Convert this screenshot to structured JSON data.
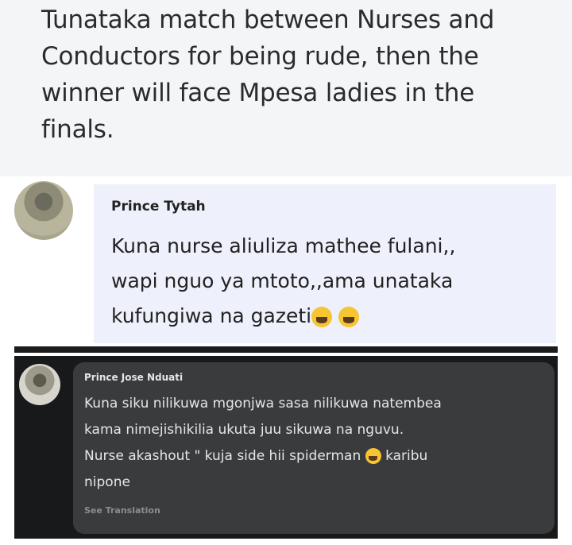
{
  "post": {
    "lines": [
      "Tunataka match between Nurses and",
      "Conductors for being rude, then the",
      "winner will face Mpesa ladies in the",
      "finals."
    ]
  },
  "comment_light": {
    "author": "Prince Tytah",
    "lines": [
      "Kuna nurse aliuliza mathee fulani,,",
      "wapi nguo ya mtoto,,ama unataka",
      "kufungiwa na gazeti"
    ],
    "emoji_icon": "laughing-emoji-icon"
  },
  "comment_dark": {
    "author": "Prince Jose Nduati",
    "lines": [
      "Kuna siku nilikuwa mgonjwa sasa nilikuwa natembea",
      "kama nimejishikilia ukuta juu sikuwa na nguvu.",
      "Nurse akashout \" kuja side hii spiderman",
      "nipone"
    ],
    "line3_tail": "karibu",
    "see_translation": "See Translation"
  }
}
